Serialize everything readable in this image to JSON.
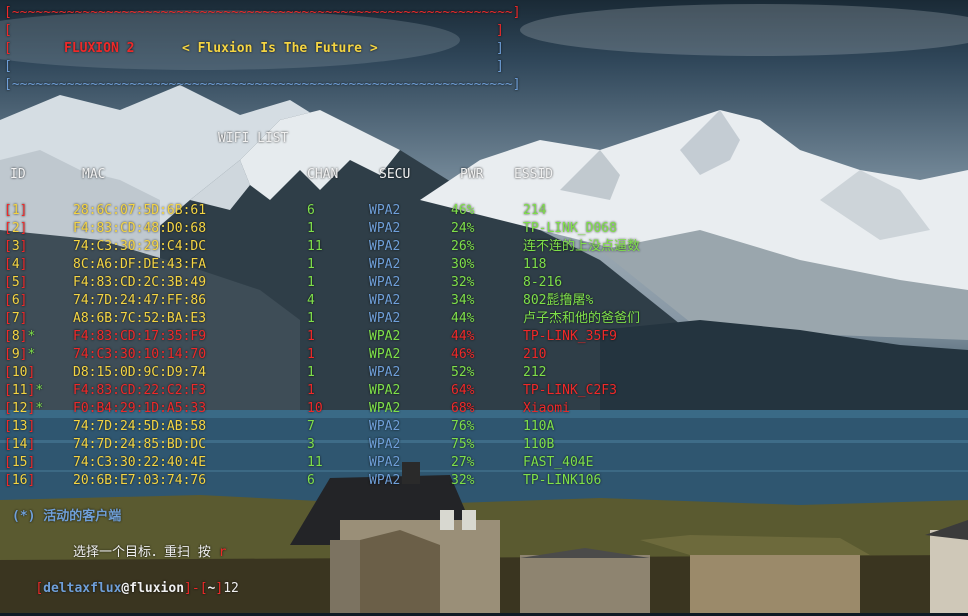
{
  "banner": {
    "border_top": "[~~~~~~~~~~~~~~~~~~~~~~~~~~~~~~~~~~~~~~~~~~~~~~~~~~~~~~~~~~~~~~~~]",
    "title": "FLUXION 2",
    "tagline": "< Fluxion Is The Future >",
    "border_bottom": "[~~~~~~~~~~~~~~~~~~~~~~~~~~~~~~~~~~~~~~~~~~~~~~~~~~~~~~~~~~~~~~~~]"
  },
  "list_title": "WIFI LIST",
  "columns": {
    "id": "ID",
    "mac": "MAC",
    "chan": "CHAN",
    "secu": "SECU",
    "pwr": "PWR",
    "essid": "ESSID"
  },
  "networks": [
    {
      "id": "1",
      "active": false,
      "mac": "28:6C:07:5D:6B:61",
      "chan": "6",
      "secu": "WPA2",
      "pwr": "46%",
      "essid": "214",
      "essid_color": "#7fe04a"
    },
    {
      "id": "2",
      "active": false,
      "mac": "F4:83:CD:48:D0:68",
      "chan": "1",
      "secu": "WPA2",
      "pwr": "24%",
      "essid": "TP-LINK_D068",
      "essid_color": "#7fe04a"
    },
    {
      "id": "3",
      "active": false,
      "mac": "74:C3:30:29:C4:DC",
      "chan": "11",
      "secu": "WPA2",
      "pwr": "26%",
      "essid": "连不连的上没点逼数",
      "essid_color": "#7fe04a"
    },
    {
      "id": "4",
      "active": false,
      "mac": "8C:A6:DF:DE:43:FA",
      "chan": "1",
      "secu": "WPA2",
      "pwr": "30%",
      "essid": "118",
      "essid_color": "#7fe04a"
    },
    {
      "id": "5",
      "active": false,
      "mac": "F4:83:CD:2C:3B:49",
      "chan": "1",
      "secu": "WPA2",
      "pwr": "32%",
      "essid": "8-216",
      "essid_color": "#7fe04a"
    },
    {
      "id": "6",
      "active": false,
      "mac": "74:7D:24:47:FF:86",
      "chan": "4",
      "secu": "WPA2",
      "pwr": "34%",
      "essid": "802髭撸屠%",
      "essid_color": "#7fe04a"
    },
    {
      "id": "7",
      "active": false,
      "mac": "A8:6B:7C:52:BA:E3",
      "chan": "1",
      "secu": "WPA2",
      "pwr": "44%",
      "essid": "卢子杰和他的爸爸们",
      "essid_color": "#7fe04a"
    },
    {
      "id": "8",
      "active": true,
      "mac": "F4:83:CD:17:35:F9",
      "chan": "1",
      "secu": "WPA2",
      "pwr": "44%",
      "essid": "TP-LINK_35F9",
      "essid_color": "#ef2929"
    },
    {
      "id": "9",
      "active": true,
      "mac": "74:C3:30:10:14:70",
      "chan": "1",
      "secu": "WPA2",
      "pwr": "46%",
      "essid": "210",
      "essid_color": "#ef2929"
    },
    {
      "id": "10",
      "active": false,
      "mac": "D8:15:0D:9C:D9:74",
      "chan": "1",
      "secu": "WPA2",
      "pwr": "52%",
      "essid": "212",
      "essid_color": "#7fe04a"
    },
    {
      "id": "11",
      "active": true,
      "mac": "F4:83:CD:22:C2:F3",
      "chan": "1",
      "secu": "WPA2",
      "pwr": "64%",
      "essid": "TP-LINK_C2F3",
      "essid_color": "#ef2929"
    },
    {
      "id": "12",
      "active": true,
      "mac": "F0:B4:29:1D:A5:33",
      "chan": "10",
      "secu": "WPA2",
      "pwr": "68%",
      "essid": "Xiaomi",
      "essid_color": "#ef2929"
    },
    {
      "id": "13",
      "active": false,
      "mac": "74:7D:24:5D:AB:58",
      "chan": "7",
      "secu": "WPA2",
      "pwr": "76%",
      "essid": "110A",
      "essid_color": "#7fe04a"
    },
    {
      "id": "14",
      "active": false,
      "mac": "74:7D:24:85:BD:DC",
      "chan": "3",
      "secu": "WPA2",
      "pwr": "75%",
      "essid": "110B",
      "essid_color": "#7fe04a"
    },
    {
      "id": "15",
      "active": false,
      "mac": "74:C3:30:22:40:4E",
      "chan": "11",
      "secu": "WPA2",
      "pwr": "27%",
      "essid": "FAST_404E",
      "essid_color": "#7fe04a"
    },
    {
      "id": "16",
      "active": false,
      "mac": "20:6B:E7:03:74:76",
      "chan": "6",
      "secu": "WPA2",
      "pwr": "32%",
      "essid": "TP-LINK106",
      "essid_color": "#7fe04a"
    }
  ],
  "legend": "(*) 活动的客户端",
  "instruction": "选择一个目标．重扫 按",
  "instruction_key": "r",
  "prompt": {
    "open": "[",
    "user": "deltaxflux",
    "at": "@",
    "host": "fluxion",
    "close": "]",
    "dash": "-",
    "dir_open": "[",
    "dir": "~",
    "dir_close": "]",
    "input": "12"
  },
  "colors": {
    "red": "#ef2929",
    "blue": "#6f9fd8",
    "yellow": "#f5d543",
    "green": "#7fe04a"
  }
}
